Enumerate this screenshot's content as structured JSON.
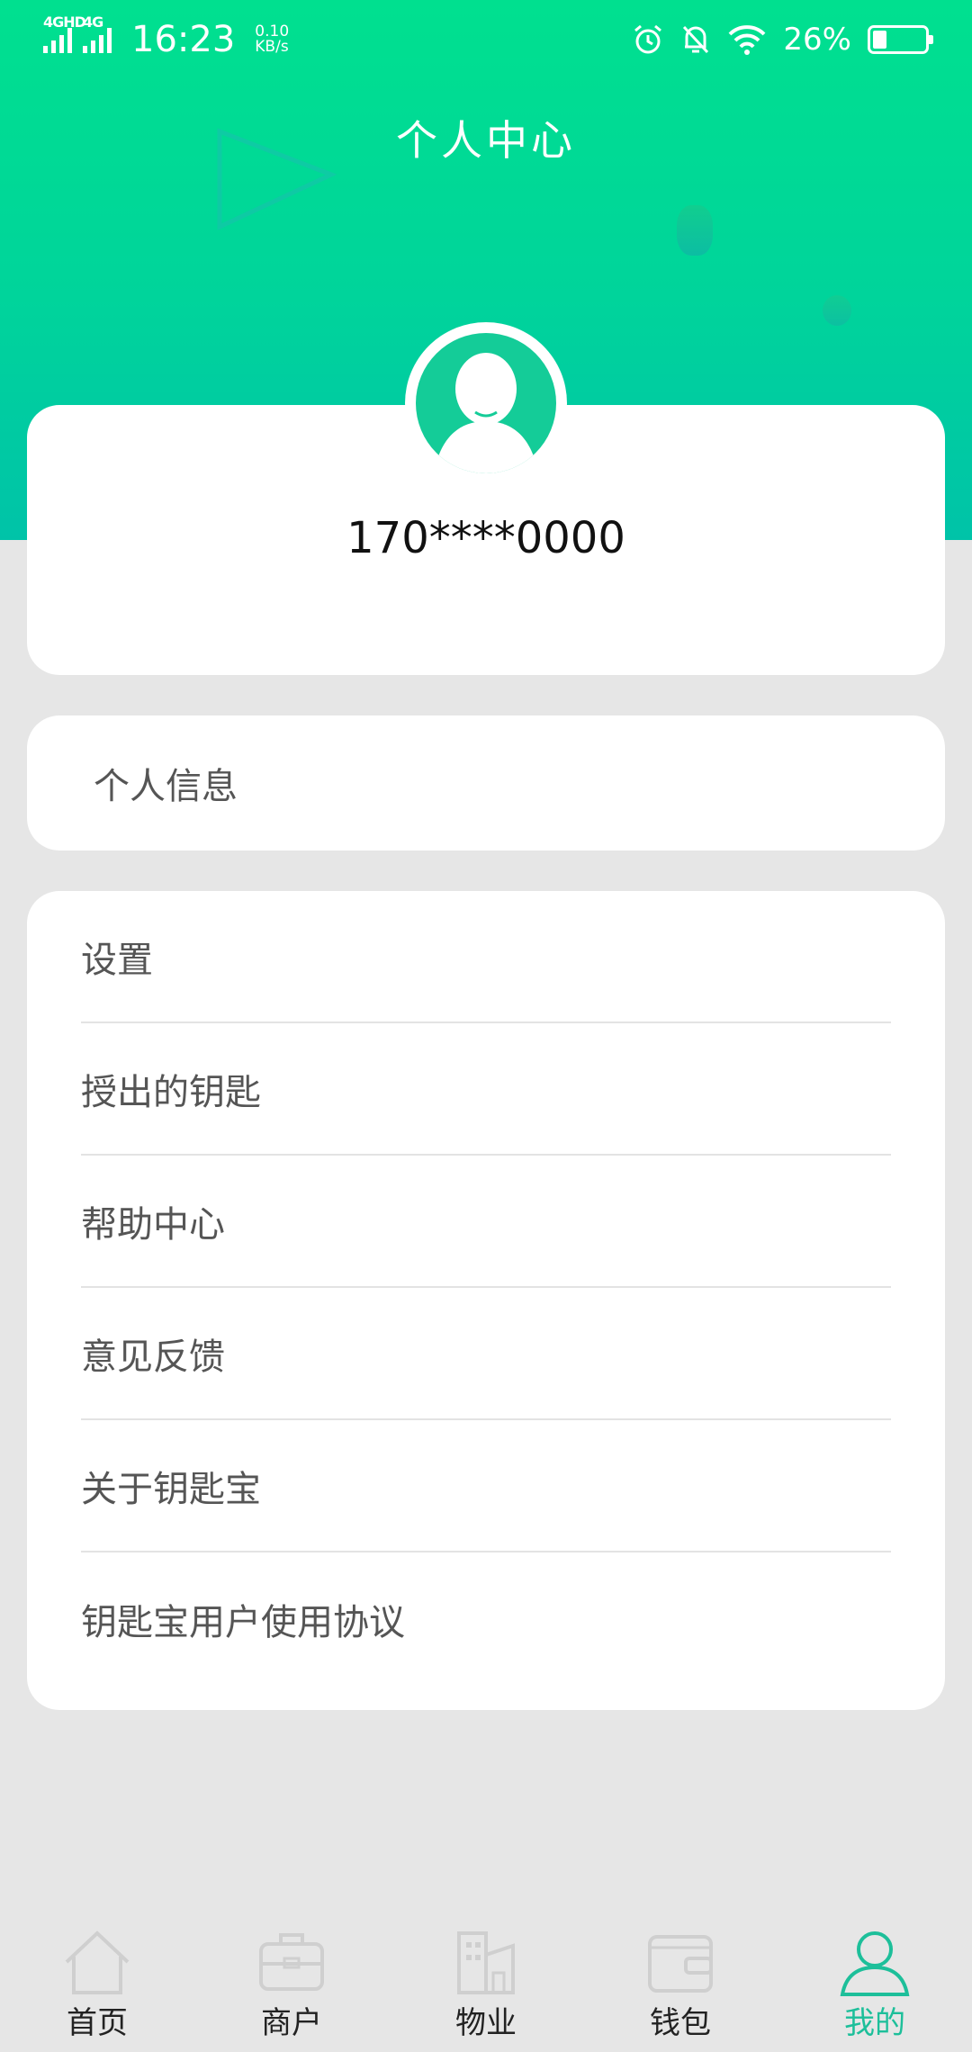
{
  "status_bar": {
    "network_1": "4GHD",
    "network_2": "4G",
    "time": "16:23",
    "speed_value": "0.10",
    "speed_unit": "KB/s",
    "battery_percent": "26%",
    "battery_level": 0.26
  },
  "header": {
    "title": "个人中心"
  },
  "profile": {
    "phone": "170****0000"
  },
  "info_card": {
    "label": "个人信息"
  },
  "menu": {
    "items": [
      {
        "label": "设置"
      },
      {
        "label": "授出的钥匙"
      },
      {
        "label": "帮助中心"
      },
      {
        "label": "意见反馈"
      },
      {
        "label": "关于钥匙宝"
      },
      {
        "label": "钥匙宝用户使用协议"
      }
    ]
  },
  "bottom_nav": {
    "items": [
      {
        "label": "首页",
        "icon": "home-icon"
      },
      {
        "label": "商户",
        "icon": "briefcase-icon"
      },
      {
        "label": "物业",
        "icon": "building-icon"
      },
      {
        "label": "钱包",
        "icon": "wallet-icon"
      },
      {
        "label": "我的",
        "icon": "user-icon",
        "active": true
      }
    ],
    "active_color": "#1dbf9a"
  },
  "colors": {
    "header_top": "#00e08f",
    "header_bottom": "#00c3a8",
    "page_bg": "#e6e6e6",
    "accent": "#14cc98"
  }
}
